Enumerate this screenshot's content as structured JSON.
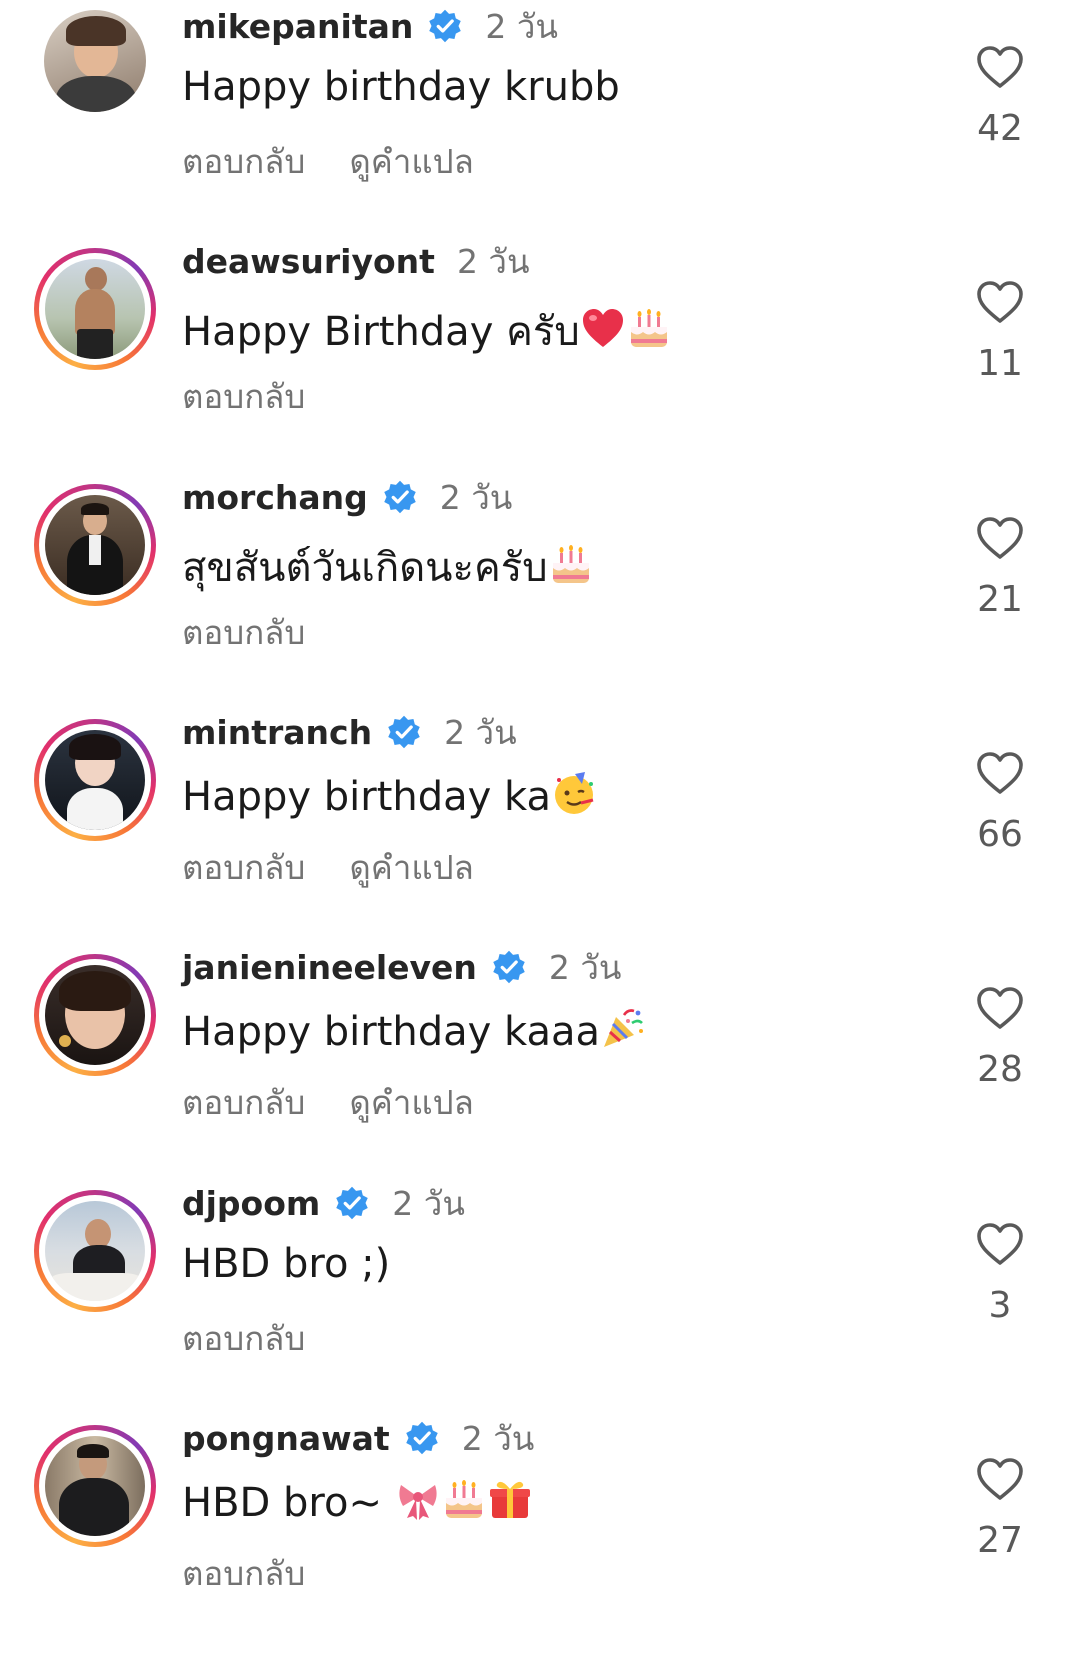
{
  "comments": [
    {
      "username": "mikepanitan",
      "verified": true,
      "time": "2 วัน",
      "text": "Happy birthday krubb",
      "emojis": [],
      "reply": "ตอบกลับ",
      "translate": "ดูคำแปล",
      "likes": "42",
      "story_ring": false
    },
    {
      "username": "deawsuriyont",
      "verified": false,
      "time": "2 วัน",
      "text": "Happy Birthday ครับ",
      "emojis": [
        "red-heart",
        "birthday-cake"
      ],
      "reply": "ตอบกลับ",
      "translate": "",
      "likes": "11",
      "story_ring": true
    },
    {
      "username": "morchang",
      "verified": true,
      "time": "2 วัน",
      "text": "สุขสันต์วันเกิดนะครับ",
      "emojis": [
        "birthday-cake"
      ],
      "reply": "ตอบกลับ",
      "translate": "",
      "likes": "21",
      "story_ring": true
    },
    {
      "username": "mintranch",
      "verified": true,
      "time": "2 วัน",
      "text": "Happy birthday ka",
      "emojis": [
        "partying-face"
      ],
      "reply": "ตอบกลับ",
      "translate": "ดูคำแปล",
      "likes": "66",
      "story_ring": true
    },
    {
      "username": "janienineeleven",
      "verified": true,
      "time": "2 วัน",
      "text": "Happy birthday kaaa",
      "emojis": [
        "party-popper"
      ],
      "reply": "ตอบกลับ",
      "translate": "ดูคำแปล",
      "likes": "28",
      "story_ring": true
    },
    {
      "username": "djpoom",
      "verified": true,
      "time": "2 วัน",
      "text": "HBD bro ;)",
      "emojis": [],
      "reply": "ตอบกลับ",
      "translate": "",
      "likes": "3",
      "story_ring": true
    },
    {
      "username": "pongnawat",
      "verified": true,
      "time": "2 วัน",
      "text": "HBD bro~ ",
      "emojis": [
        "ribbon",
        "birthday-cake",
        "wrapped-gift"
      ],
      "reply": "ตอบกลับ",
      "translate": "",
      "likes": "27",
      "story_ring": true
    }
  ],
  "colors": {
    "verified_blue": "#3897f0",
    "muted_text": "#737373",
    "primary_text": "#262626"
  }
}
